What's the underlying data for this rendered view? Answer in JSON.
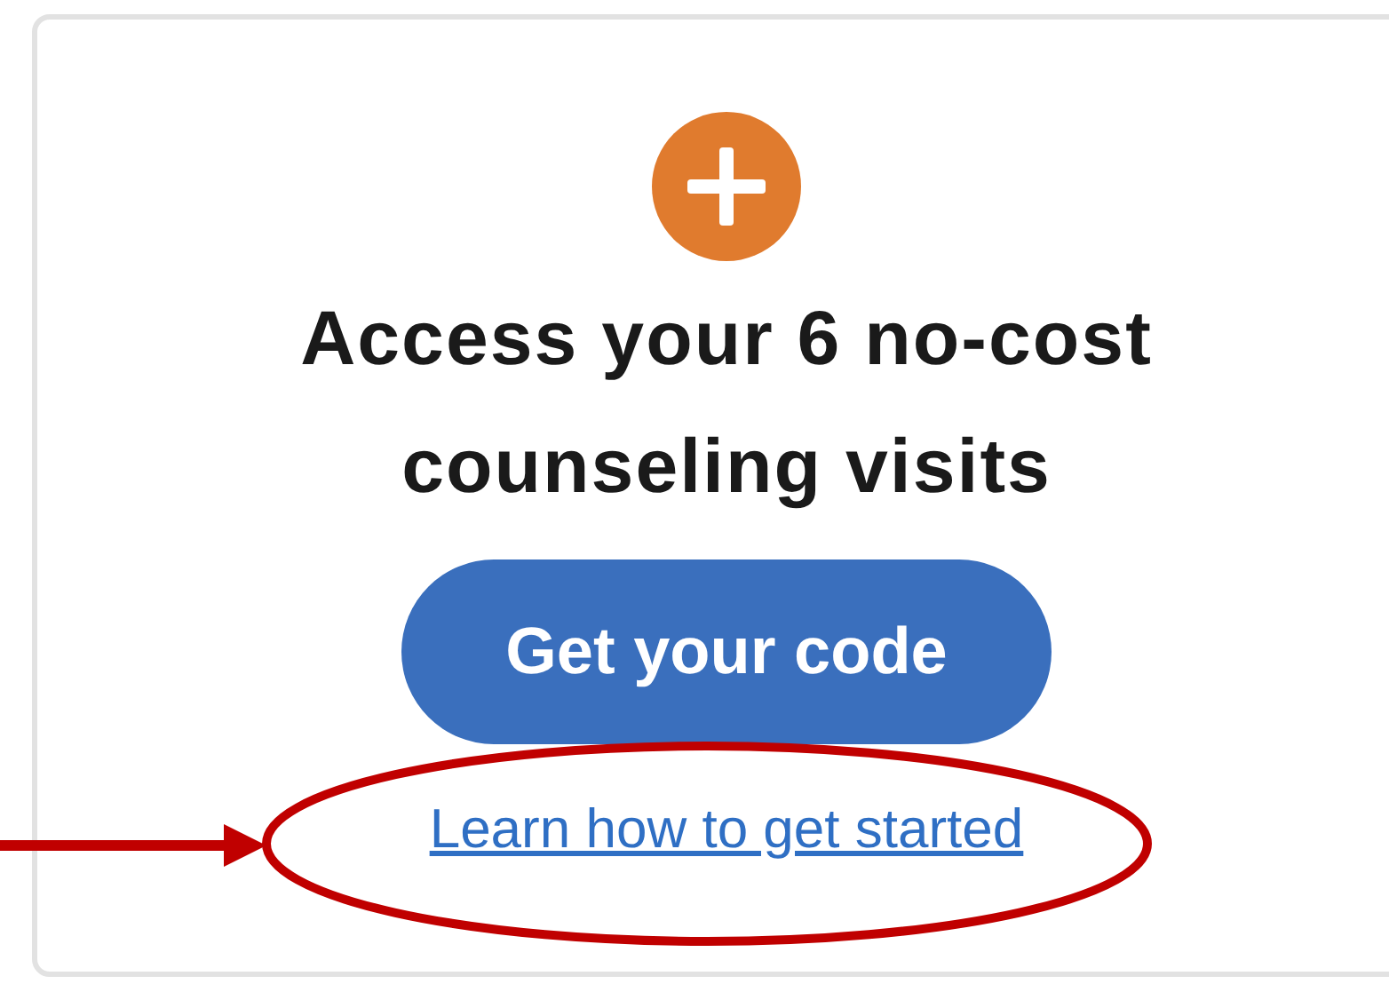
{
  "card": {
    "heading": "Access your 6 no-cost counseling visits",
    "button": "Get your code",
    "link": "Learn how to get started"
  }
}
